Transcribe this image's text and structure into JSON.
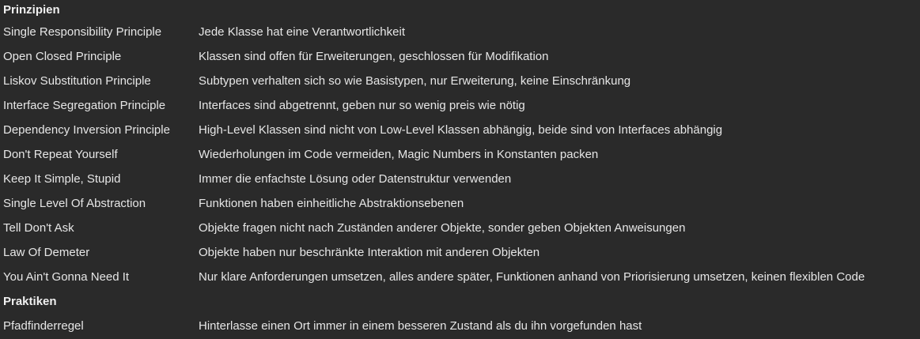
{
  "sections": [
    {
      "heading": "Prinzipien",
      "rows": [
        {
          "name": "Single Responsibility Principle",
          "desc": "Jede Klasse hat eine Verantwortlichkeit"
        },
        {
          "name": "Open Closed Principle",
          "desc": "Klassen sind offen für Erweiterungen, geschlossen für Modifikation"
        },
        {
          "name": "Liskov Substitution Principle",
          "desc": "Subtypen verhalten sich so wie Basistypen, nur Erweiterung, keine Einschränkung"
        },
        {
          "name": "Interface Segregation Principle",
          "desc": "Interfaces sind abgetrennt, geben nur so wenig preis wie nötig"
        },
        {
          "name": "Dependency Inversion Principle",
          "desc": "High-Level Klassen sind nicht von Low-Level Klassen abhängig, beide sind von Interfaces abhängig"
        },
        {
          "name": "Don't Repeat Yourself",
          "desc": "Wiederholungen im Code vermeiden, Magic Numbers in Konstanten packen"
        },
        {
          "name": "Keep It Simple, Stupid",
          "desc": "Immer die enfachste Lösung oder Datenstruktur verwenden"
        },
        {
          "name": "Single Level Of Abstraction",
          "desc": "Funktionen haben einheitliche Abstraktionsebenen"
        },
        {
          "name": "Tell Don't Ask",
          "desc": "Objekte fragen nicht nach Zuständen anderer Objekte, sonder geben Objekten Anweisungen"
        },
        {
          "name": "Law Of Demeter",
          "desc": "Objekte haben nur beschränkte Interaktion mit anderen Objekten"
        },
        {
          "name": "You Ain't Gonna Need It",
          "desc": "Nur klare Anforderungen umsetzen, alles andere später, Funktionen anhand von Priorisierung umsetzen, keinen flexiblen Code"
        }
      ]
    },
    {
      "heading": "Praktiken",
      "rows": [
        {
          "name": "Pfadfinderregel",
          "desc": "Hinterlasse einen Ort immer in einem besseren Zustand als du ihn vorgefunden hast"
        }
      ]
    }
  ]
}
